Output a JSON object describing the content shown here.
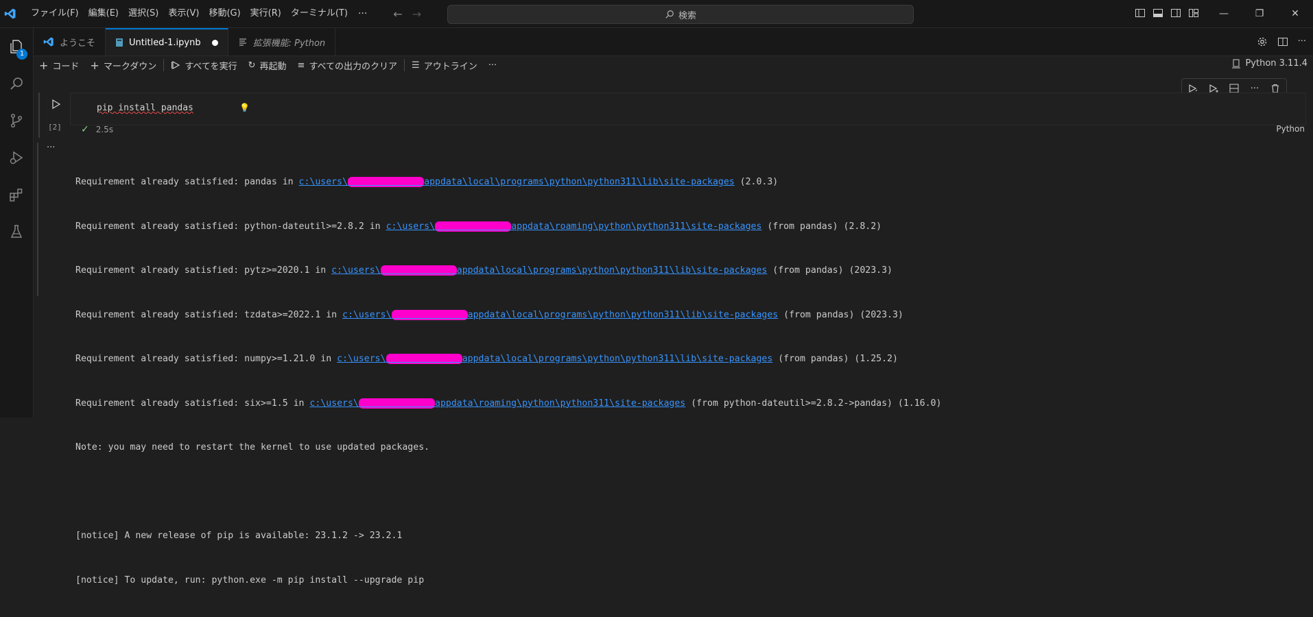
{
  "menu": {
    "items": [
      "ファイル(F)",
      "編集(E)",
      "選択(S)",
      "表示(V)",
      "移動(G)",
      "実行(R)",
      "ターミナル(T)"
    ],
    "more": "···"
  },
  "search": {
    "label": "検索"
  },
  "activity": {
    "explorer_badge": "1"
  },
  "tabs": [
    {
      "label": "ようこそ"
    },
    {
      "label": "Untitled-1.ipynb"
    },
    {
      "label": "拡張機能: Python"
    }
  ],
  "toolbar": {
    "code": "コード",
    "markdown": "マークダウン",
    "run_all": "すべてを実行",
    "restart": "再起動",
    "clear_all": "すべての出力のクリア",
    "outline": "アウトライン",
    "more": "···",
    "kernel": "Python 3.11.4"
  },
  "cell": {
    "code": "pip install pandas",
    "exec_count": "[2]",
    "duration": "2.5s",
    "language": "Python"
  },
  "output": {
    "more": "···",
    "lines": [
      {
        "pre": "Requirement already satisfied: pandas in ",
        "link_a": "c:\\users\\",
        "link_b": "appdata\\local\\programs\\python\\python311\\lib\\site-packages",
        "post": " (2.0.3)"
      },
      {
        "pre": "Requirement already satisfied: python-dateutil>=2.8.2 in ",
        "link_a": "c:\\users\\",
        "link_b": "appdata\\roaming\\python\\python311\\site-packages",
        "post": " (from pandas) (2.8.2)"
      },
      {
        "pre": "Requirement already satisfied: pytz>=2020.1 in ",
        "link_a": "c:\\users\\",
        "link_b": "appdata\\local\\programs\\python\\python311\\lib\\site-packages",
        "post": " (from pandas) (2023.3)"
      },
      {
        "pre": "Requirement already satisfied: tzdata>=2022.1 in ",
        "link_a": "c:\\users\\",
        "link_b": "appdata\\local\\programs\\python\\python311\\lib\\site-packages",
        "post": " (from pandas) (2023.3)"
      },
      {
        "pre": "Requirement already satisfied: numpy>=1.21.0 in ",
        "link_a": "c:\\users\\",
        "link_b": "appdata\\local\\programs\\python\\python311\\lib\\site-packages",
        "post": " (from pandas) (1.25.2)"
      },
      {
        "pre": "Requirement already satisfied: six>=1.5 in ",
        "link_a": "c:\\users\\",
        "link_b": "appdata\\roaming\\python\\python311\\site-packages",
        "post": " (from python-dateutil>=2.8.2->pandas) (1.16.0)"
      }
    ],
    "note": "Note: you may need to restart the kernel to use updated packages.",
    "notice1": "[notice] A new release of pip is available: 23.1.2 -> 23.2.1",
    "notice2": "[notice] To update, run: python.exe -m pip install --upgrade pip"
  },
  "colors": {
    "accent": "#0078d4",
    "link": "#3794ff",
    "redaction": "#ff00cc",
    "success": "#89d185"
  }
}
